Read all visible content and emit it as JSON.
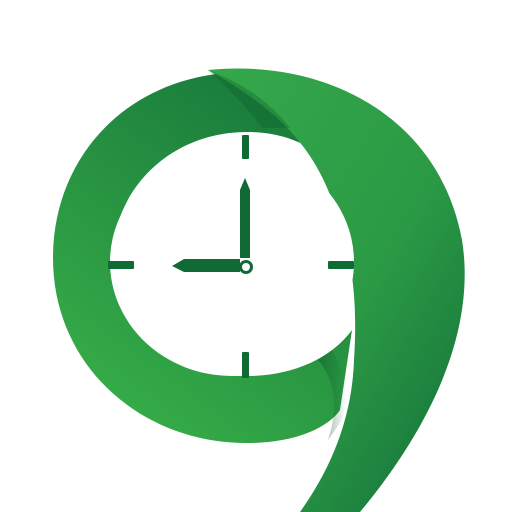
{
  "logo": {
    "icon": "nine-clock-icon",
    "clock_time": "9:00",
    "colors": {
      "background": "#ffffff",
      "green_light": "#3bb54a",
      "green_mid": "#2e9e44",
      "green_dark": "#16743a",
      "clock_face": "#ffffff",
      "clock_marks": "#0f6a35"
    }
  }
}
